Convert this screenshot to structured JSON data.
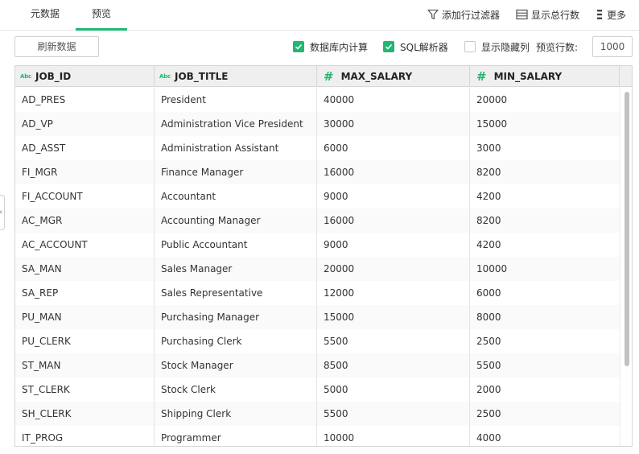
{
  "tabs": [
    {
      "label": "元数据",
      "active": false
    },
    {
      "label": "预览",
      "active": true
    }
  ],
  "actions": {
    "add_filter": "添加行过滤器",
    "show_total": "显示总行数",
    "more": "更多"
  },
  "toolbar": {
    "refresh": "刷新数据",
    "db_compute": {
      "label": "数据库内计算",
      "checked": true
    },
    "sql_parser": {
      "label": "SQL解析器",
      "checked": true
    },
    "show_hidden": {
      "label": "显示隐藏列",
      "checked": false
    },
    "preview_rows_label": "预览行数:",
    "preview_rows_value": "1000"
  },
  "colors": {
    "accent": "#22b573"
  },
  "table": {
    "columns": [
      {
        "name": "JOB_ID",
        "type": "Abc"
      },
      {
        "name": "JOB_TITLE",
        "type": "Abc"
      },
      {
        "name": "MAX_SALARY",
        "type": "#"
      },
      {
        "name": "MIN_SALARY",
        "type": "#"
      }
    ],
    "rows": [
      [
        "AD_PRES",
        "President",
        "40000",
        "20000"
      ],
      [
        "AD_VP",
        "Administration Vice President",
        "30000",
        "15000"
      ],
      [
        "AD_ASST",
        "Administration Assistant",
        "6000",
        "3000"
      ],
      [
        "FI_MGR",
        "Finance Manager",
        "16000",
        "8200"
      ],
      [
        "FI_ACCOUNT",
        "Accountant",
        "9000",
        "4200"
      ],
      [
        "AC_MGR",
        "Accounting Manager",
        "16000",
        "8200"
      ],
      [
        "AC_ACCOUNT",
        "Public Accountant",
        "9000",
        "4200"
      ],
      [
        "SA_MAN",
        "Sales Manager",
        "20000",
        "10000"
      ],
      [
        "SA_REP",
        "Sales Representative",
        "12000",
        "6000"
      ],
      [
        "PU_MAN",
        "Purchasing Manager",
        "15000",
        "8000"
      ],
      [
        "PU_CLERK",
        "Purchasing Clerk",
        "5500",
        "2500"
      ],
      [
        "ST_MAN",
        "Stock Manager",
        "8500",
        "5500"
      ],
      [
        "ST_CLERK",
        "Stock Clerk",
        "5000",
        "2000"
      ],
      [
        "SH_CLERK",
        "Shipping Clerk",
        "5500",
        "2500"
      ],
      [
        "IT_PROG",
        "Programmer",
        "10000",
        "4000"
      ]
    ]
  },
  "side_handle_glyph": "‹"
}
